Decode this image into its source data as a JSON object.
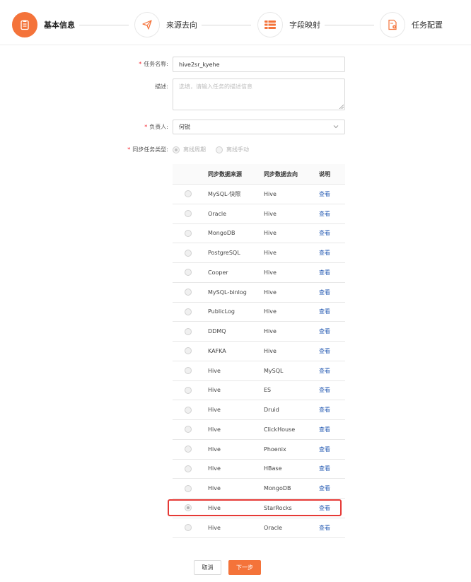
{
  "steps": [
    {
      "label": "基本信息",
      "active": true,
      "icon": "clipboard-icon"
    },
    {
      "label": "来源去向",
      "active": false,
      "icon": "paper-plane-icon"
    },
    {
      "label": "字段映射",
      "active": false,
      "icon": "mapping-list-icon"
    },
    {
      "label": "任务配置",
      "active": false,
      "icon": "settings-document-icon"
    }
  ],
  "form": {
    "task_name_label": "任务名称:",
    "task_name_value": "hive2sr_kyehe",
    "description_label": "描述:",
    "description_placeholder": "选填，请输入任务的描述信息",
    "owner_label": "负责人:",
    "owner_value": "何锐",
    "sync_type_label": "同步任务类型:",
    "sync_type_options": [
      "离线周期",
      "离线手动"
    ],
    "sync_type_selected": "离线周期"
  },
  "table": {
    "headers": [
      "同步数据来源",
      "同步数据去向",
      "说明"
    ],
    "rows": [
      {
        "source": "MySQL-快照",
        "target": "Hive",
        "action": "查看"
      },
      {
        "source": "Oracle",
        "target": "Hive",
        "action": "查看"
      },
      {
        "source": "MongoDB",
        "target": "Hive",
        "action": "查看"
      },
      {
        "source": "PostgreSQL",
        "target": "Hive",
        "action": "查看"
      },
      {
        "source": "Cooper",
        "target": "Hive",
        "action": "查看"
      },
      {
        "source": "MySQL-binlog",
        "target": "Hive",
        "action": "查看"
      },
      {
        "source": "PublicLog",
        "target": "Hive",
        "action": "查看"
      },
      {
        "source": "DDMQ",
        "target": "Hive",
        "action": "查看"
      },
      {
        "source": "KAFKA",
        "target": "Hive",
        "action": "查看"
      },
      {
        "source": "Hive",
        "target": "MySQL",
        "action": "查看"
      },
      {
        "source": "Hive",
        "target": "ES",
        "action": "查看"
      },
      {
        "source": "Hive",
        "target": "Druid",
        "action": "查看"
      },
      {
        "source": "Hive",
        "target": "ClickHouse",
        "action": "查看"
      },
      {
        "source": "Hive",
        "target": "Phoenix",
        "action": "查看"
      },
      {
        "source": "Hive",
        "target": "HBase",
        "action": "查看"
      },
      {
        "source": "Hive",
        "target": "MongoDB",
        "action": "查看"
      },
      {
        "source": "Hive",
        "target": "StarRocks",
        "action": "查看",
        "selected": true
      },
      {
        "source": "Hive",
        "target": "Oracle",
        "action": "查看"
      }
    ]
  },
  "buttons": {
    "cancel": "取消",
    "next": "下一步"
  },
  "colors": {
    "accent": "#f4733a",
    "link": "#2b5fb5",
    "highlight": "#e53935"
  }
}
